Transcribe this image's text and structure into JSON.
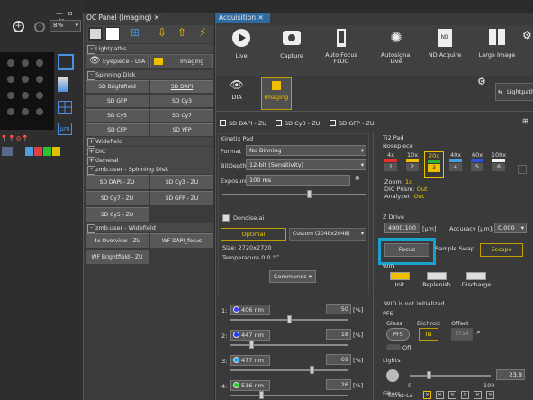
{
  "left": {
    "zoom": "8%",
    "units": "µm"
  },
  "oc_panel": {
    "title": "OC Panel (Imaging)",
    "lightpaths": {
      "header": "Lightpaths",
      "eyepiece": "Eyepiece - DIA",
      "imaging": "Imaging"
    },
    "spinning_disk": {
      "header": "Spinning Disk",
      "buttons": [
        "SD Brightfield",
        "SD DAPI",
        "SD GFP",
        "SD Cy3",
        "SD Cy5",
        "SD Cy7",
        "SD CFP",
        "SD YFP"
      ]
    },
    "sections": [
      "Widefield",
      "DIC",
      "General",
      "zmb.user - Spinning Disk"
    ],
    "zmb_sd": {
      "buttons": [
        "SD DAPI - ZU",
        "SD Cy3 - ZU",
        "SD Cy7 - ZU",
        "SD GFP - ZU",
        "SD Cy5 - ZU"
      ]
    },
    "zmb_wf": {
      "header": "zmb.user - Widefield",
      "buttons": [
        "4x Overview - ZU",
        "WF DAPI_focus",
        "WF Brightfield - ZU"
      ]
    }
  },
  "acquisition": {
    "title": "Acquisition",
    "toolbar": [
      "Live",
      "Capture",
      "Auto Focus FLUO",
      "Autosignal Live",
      "ND Acquire",
      "Large Image"
    ],
    "modes": [
      "DIA",
      "Imaging"
    ],
    "lightpath": "Lightpath",
    "chips": [
      "SD DAPI - ZU",
      "SD Cy3 - ZU",
      "SD GFP - ZU"
    ],
    "kinetix": {
      "header": "Kinetix Pad",
      "format_label": "Format",
      "format_value": "No Binning",
      "bitdepth_label": "BitDepth",
      "bitdepth_value": "12-bit (Sensitivity)",
      "exposure_label": "Exposure",
      "exposure_value": "100 ms",
      "denoise": "Denoise.ai",
      "optimal": "Optimal",
      "custom": "Custom (2048x2048)",
      "size": "Size: 2720x2720",
      "temperature": "Temperature 0.0 °C",
      "commands": "Commands"
    },
    "lasers": [
      {
        "num": "1:",
        "name": "406 nm",
        "value": "50",
        "unit": "[%]",
        "color": "#3b3bff",
        "level": 0.5
      },
      {
        "num": "2:",
        "name": "447 nm",
        "value": "18",
        "unit": "[%]",
        "color": "#1f3cff",
        "level": 0.18
      },
      {
        "num": "3:",
        "name": "477 nm",
        "value": "69",
        "unit": "[%]",
        "color": "#18a8ff",
        "level": 0.69
      },
      {
        "num": "4:",
        "name": "516 nm",
        "value": "26",
        "unit": "[%]",
        "color": "#20d020",
        "level": 0.26
      }
    ],
    "ti2": {
      "header": "Ti2 Pad",
      "nosepiece": "Nosepiece",
      "objectives": [
        {
          "mag": "4x",
          "num": "1",
          "color": "#e53030"
        },
        {
          "mag": "10x",
          "num": "2",
          "color": "#f0c000"
        },
        {
          "mag": "20x",
          "num": "3",
          "color": "#30b030"
        },
        {
          "mag": "40x",
          "num": "4",
          "color": "#40a0e0"
        },
        {
          "mag": "60x",
          "num": "5",
          "color": "#3050e0"
        },
        {
          "mag": "100x",
          "num": "6",
          "color": "#f0f0f0"
        }
      ],
      "zoom_label": "Zoom:",
      "zoom_value": "1x",
      "dic_label": "DIC Prism:",
      "dic_value": "Out",
      "analyzer_label": "Analyzer:",
      "analyzer_value": "Out",
      "zdrive": "Z Drive",
      "z_value": "4900.100",
      "z_unit": "[µm]",
      "accuracy_label": "Accuracy [µm]:",
      "accuracy_value": "0.000",
      "focus": "Focus",
      "sample_swap": "Sample Swap",
      "escape": "Escape",
      "wid": "WID",
      "wid_buttons": [
        "Init",
        "Replenish",
        "Discharge"
      ],
      "wid_status": "WID is not initialized",
      "pfs": "PFS",
      "pfs_cols": [
        "Glass",
        "Dichroic",
        "Offset"
      ],
      "pfs_btn": "PFS",
      "in_btn": "IN",
      "offset_value": "5714",
      "off_label": "Off",
      "lights": "Lights",
      "light_min": "0",
      "light_max": "100",
      "light_value": "23.8",
      "light_level": 0.238,
      "filters": "Filters",
      "turret": "Turret-Lo"
    }
  }
}
